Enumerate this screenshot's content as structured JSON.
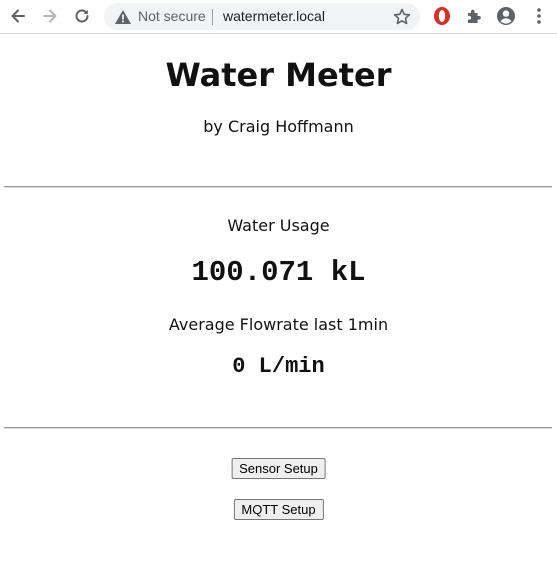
{
  "browser": {
    "security_label": "Not secure",
    "url": "watermeter.local",
    "accent_color": "#d93025"
  },
  "page": {
    "title": "Water Meter",
    "byline": "by Craig Hoffmann",
    "usage": {
      "label": "Water Usage",
      "value": "100.071 kL"
    },
    "flowrate": {
      "label": "Average Flowrate last 1min",
      "value": "0 L/min"
    },
    "buttons": {
      "sensor_setup": "Sensor Setup",
      "mqtt_setup": "MQTT Setup"
    }
  }
}
